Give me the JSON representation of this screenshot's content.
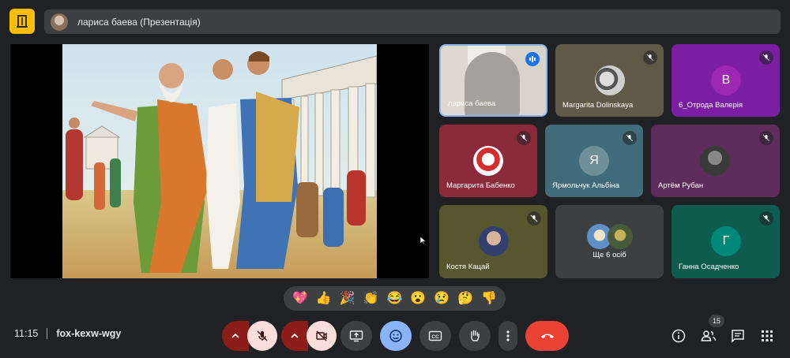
{
  "header": {
    "presenter_label": "лариса баева (Презентація)"
  },
  "participants": [
    {
      "name": "лариса баева"
    },
    {
      "name": "Margarita Dolinskaya"
    },
    {
      "name": "6_Отрода Валерія",
      "initial": "В"
    },
    {
      "name": "Маргарита Бабенко"
    },
    {
      "name": "Ярмольчук Альбіна",
      "initial": "Я"
    },
    {
      "name": "Артём Рубан"
    },
    {
      "name": "Костя Кацай"
    },
    {
      "name": "Ще 6 осіб"
    },
    {
      "name": "Ганна Осадченко",
      "initial": "Г"
    }
  ],
  "reactions": [
    "💖",
    "👍",
    "🎉",
    "👏",
    "😂",
    "😮",
    "😢",
    "🤔",
    "👎"
  ],
  "footer": {
    "time": "11:15",
    "meeting_code": "fox-kexw-wgy",
    "people_count": "15"
  },
  "colors": {
    "end_call": "#ea4335",
    "active_blue": "#8ab4f8",
    "mic_off_bg": "#f9dedc",
    "mic_off_split": "#8c1d18"
  }
}
